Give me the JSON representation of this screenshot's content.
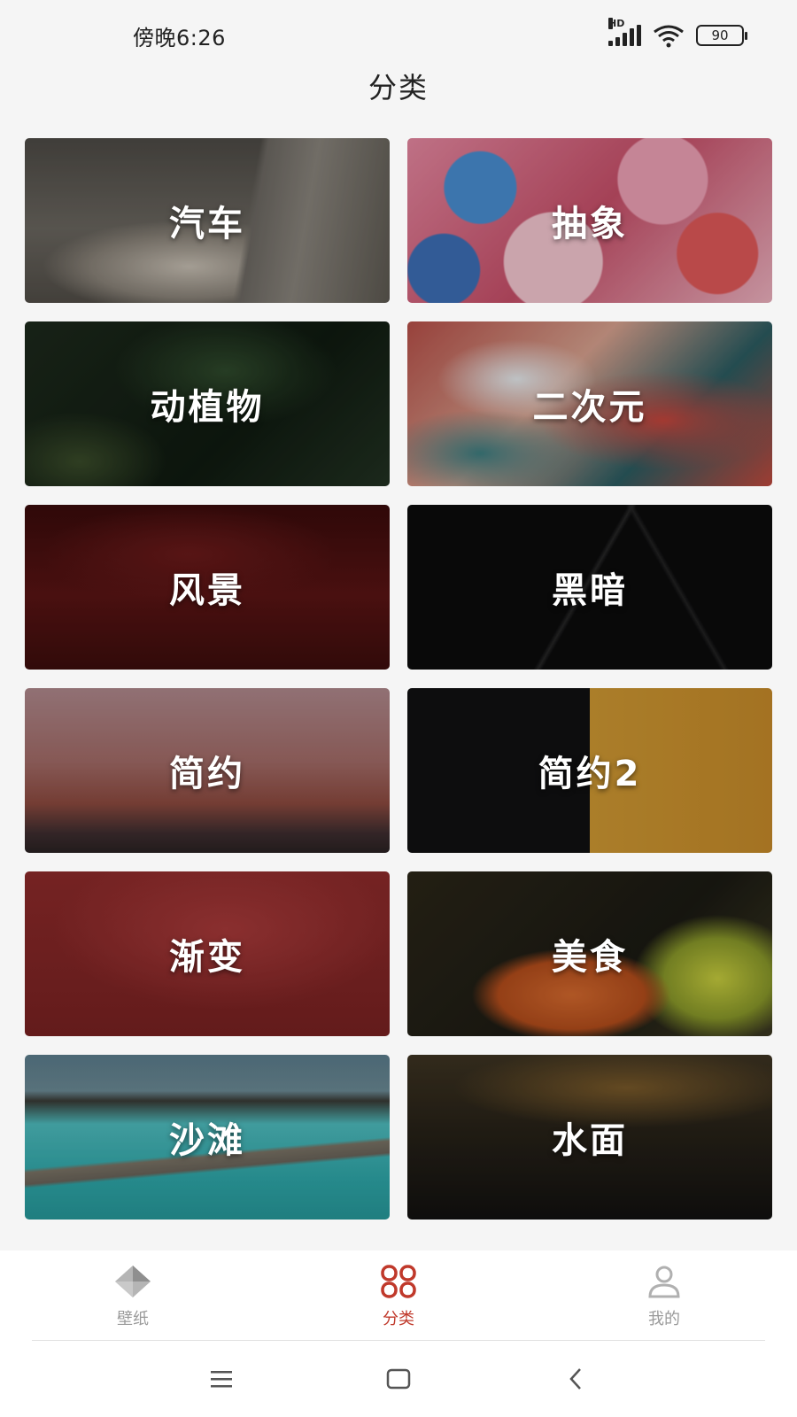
{
  "status_bar": {
    "time": "傍晚6:26",
    "signal_label": "HD",
    "battery": "90"
  },
  "page": {
    "title": "分类"
  },
  "categories": [
    {
      "label": "汽车"
    },
    {
      "label": "抽象"
    },
    {
      "label": "动植物"
    },
    {
      "label": "二次元"
    },
    {
      "label": "风景"
    },
    {
      "label": "黑暗"
    },
    {
      "label": "简约"
    },
    {
      "label": "简约2"
    },
    {
      "label": "渐变"
    },
    {
      "label": "美食"
    },
    {
      "label": "沙滩"
    },
    {
      "label": "水面"
    }
  ],
  "bottom_nav": {
    "items": [
      {
        "label": "壁纸",
        "icon": "diamond-icon"
      },
      {
        "label": "分类",
        "icon": "grid-icon",
        "active": true
      },
      {
        "label": "我的",
        "icon": "person-icon"
      }
    ]
  },
  "colors": {
    "accent": "#c0392b",
    "inactive": "#9a9a9a",
    "background": "#f5f5f5"
  }
}
